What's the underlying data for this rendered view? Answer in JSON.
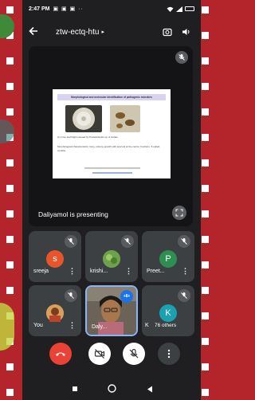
{
  "status_bar": {
    "time": "2:47 PM",
    "indicators": "▣ ▣ ▣ ··",
    "battery_label": ""
  },
  "meeting": {
    "code": "ztw-ectq-htu",
    "chevron": "▸"
  },
  "presentation": {
    "presenter_label": "Daliyamol is presenting",
    "slide_title": "Morphological and molecular identification of pathogenic microbes",
    "slide_caption": "(1) Grey leaf blight caused by Pestalotiopsis sp. & Isolate",
    "slide_body": "Morphological characteristics: Grey, cottony growth with acervuli at the centre; Fusiform, 5-celled, conidia..."
  },
  "participants": [
    {
      "name": "sreeja",
      "initial": "s",
      "avatar_color": "#e8552b"
    },
    {
      "name": "krishi...",
      "initial": "",
      "avatar_color": "#6ea24a"
    },
    {
      "name": "Preet...",
      "initial": "P",
      "avatar_color": "#2f8f53"
    },
    {
      "name": "You",
      "initial": "",
      "avatar_color": "#c46a3a"
    },
    {
      "name": "Daly...",
      "initial": "",
      "avatar_color": "#7a6a58"
    },
    {
      "name": "K",
      "initial": "K",
      "avatar_color": "#1aa2b0"
    }
  ],
  "others_label": "76 others",
  "speaking_badge": "+8+",
  "colors": {
    "accent_red": "#ea4335",
    "tile": "#3c4043",
    "bg": "#1f1f21"
  },
  "icons": [
    "back-arrow-icon",
    "switch-camera-icon",
    "speaker-icon",
    "mic-off-icon",
    "expand-icon",
    "end-call-icon",
    "camera-off-icon",
    "more-icon"
  ]
}
